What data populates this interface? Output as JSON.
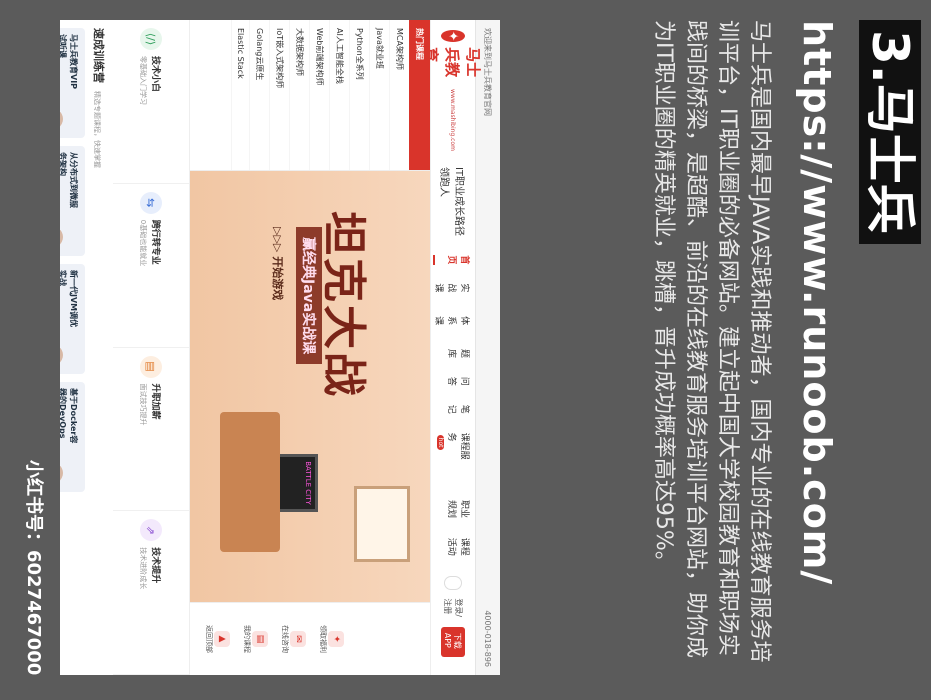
{
  "heading": "3.马士兵",
  "url": "https://www.runoob.com/",
  "description": "马士兵是国内最早JAVA实践和推动者，国内专业的在线教育服务培训平台，IT职业圈的必备网站。建立起中国大学校园教育和职场实践间的桥梁，是超酷、前沿的在线教育服务培训平台网站，助你成为IT职业圈的精英就业，跳槽，晋升成功概率高达95%。",
  "watermark": "小红书号：6027467000",
  "site": {
    "topbar_left": "欢迎来到马士兵教育官网",
    "topbar_right": "4000-018-896",
    "logo": "马士兵教育",
    "logo_sub": "www.mashibing.com",
    "slogan": "IT职业成长路径领跑人",
    "nav": [
      "首页",
      "实战课",
      "体系课",
      "题库",
      "问答",
      "笔记",
      "课程服务",
      "职业规划",
      "课程活动"
    ],
    "nav_hot": "hot",
    "download": "下载APP",
    "login": "登录/注册",
    "menu_header": "热门课程",
    "menu": [
      "MCA架构师",
      "Java就业班",
      "Python全系列",
      "AI人工智能全栈",
      "Web前端架构师",
      "大数据架构师",
      "IoT嵌入式架构师",
      "Golang云原生",
      "Elastic Stack"
    ],
    "banner_title": "坦克大战",
    "banner_sub": "赢经典Java实战课",
    "banner_btn": "▷▷▷ 开始游戏",
    "monitor": "BATTLE CITY",
    "right_panel": [
      "领取福利",
      "在线咨询",
      "我的课程",
      "返回顶部"
    ],
    "cards": [
      {
        "title": "技术小白",
        "sub": "零基础入门学习",
        "icon": "⟨/⟩",
        "color": "#e7f6ec",
        "fg": "#2e9e5b"
      },
      {
        "title": "跨行转专业",
        "sub": "0基础也能就业",
        "icon": "⇆",
        "color": "#e7eefc",
        "fg": "#3b6fd6"
      },
      {
        "title": "升职加薪",
        "sub": "面试技巧提升",
        "icon": "▤",
        "color": "#fdeee0",
        "fg": "#e07a2d"
      },
      {
        "title": "技术提升",
        "sub": "技术进阶成长",
        "icon": "⇗",
        "color": "#f3e9fc",
        "fg": "#8a4ed1"
      }
    ],
    "section_title": "速成训练营",
    "section_sub": "精选专题课程，快速掌握",
    "courses": [
      "马士兵教育VIP试听课",
      "从分布式到微服务架构",
      "新一代JVM调优实战",
      "基于Docker容器的DevOps"
    ]
  }
}
